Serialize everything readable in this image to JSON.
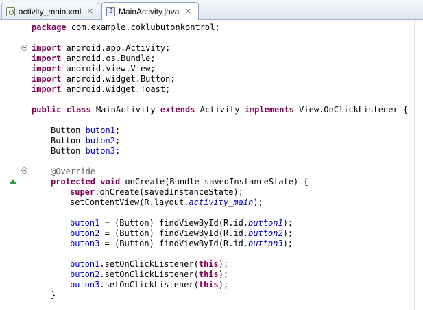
{
  "tabs": [
    {
      "label": "activity_main.xml",
      "icon": "xml-file-icon",
      "active": false
    },
    {
      "label": "MainActivity.java",
      "icon": "java-file-icon",
      "active": true
    }
  ],
  "code": {
    "l1": [
      "package",
      " com.example.coklubutonkontrol;"
    ],
    "l3": [
      "import",
      " android.app.Activity;"
    ],
    "l4": [
      "import",
      " android.os.Bundle;"
    ],
    "l5": [
      "import",
      " android.view.View;"
    ],
    "l6": [
      "import",
      " android.widget.Button;"
    ],
    "l7": [
      "import",
      " android.widget.Toast;"
    ],
    "l9": [
      "public",
      " ",
      "class",
      " MainActivity ",
      "extends",
      " Activity ",
      "implements",
      " View.OnClickListener {"
    ],
    "l11": [
      "Button ",
      "buton1",
      ";"
    ],
    "l12": [
      "Button ",
      "buton2",
      ";"
    ],
    "l13": [
      "Button ",
      "buton3",
      ";"
    ],
    "l15": [
      "@Override"
    ],
    "l16": [
      "protected",
      " ",
      "void",
      " onCreate(Bundle savedInstanceState) {"
    ],
    "l17": [
      "super",
      ".onCreate(savedInstanceState);"
    ],
    "l18": [
      "setContentView(R.layout.",
      "activity_main",
      ");"
    ],
    "l20": [
      "buton1",
      " = (Button) findViewById(R.id.",
      "button1",
      ");"
    ],
    "l21": [
      "buton2",
      " = (Button) findViewById(R.id.",
      "button2",
      ");"
    ],
    "l22": [
      "buton3",
      " = (Button) findViewById(R.id.",
      "button3",
      ");"
    ],
    "l24": [
      "buton1",
      ".setOnClickListener(",
      "this",
      ");"
    ],
    "l25": [
      "buton2",
      ".setOnClickListener(",
      "this",
      ");"
    ],
    "l26": [
      "buton3",
      ".setOnClickListener(",
      "this",
      ");"
    ],
    "l27": [
      "}"
    ]
  },
  "colors": {
    "keyword": "#7f0055",
    "field": "#0000c0",
    "annotation": "#646464",
    "override_marker": "#2e9b3a"
  }
}
